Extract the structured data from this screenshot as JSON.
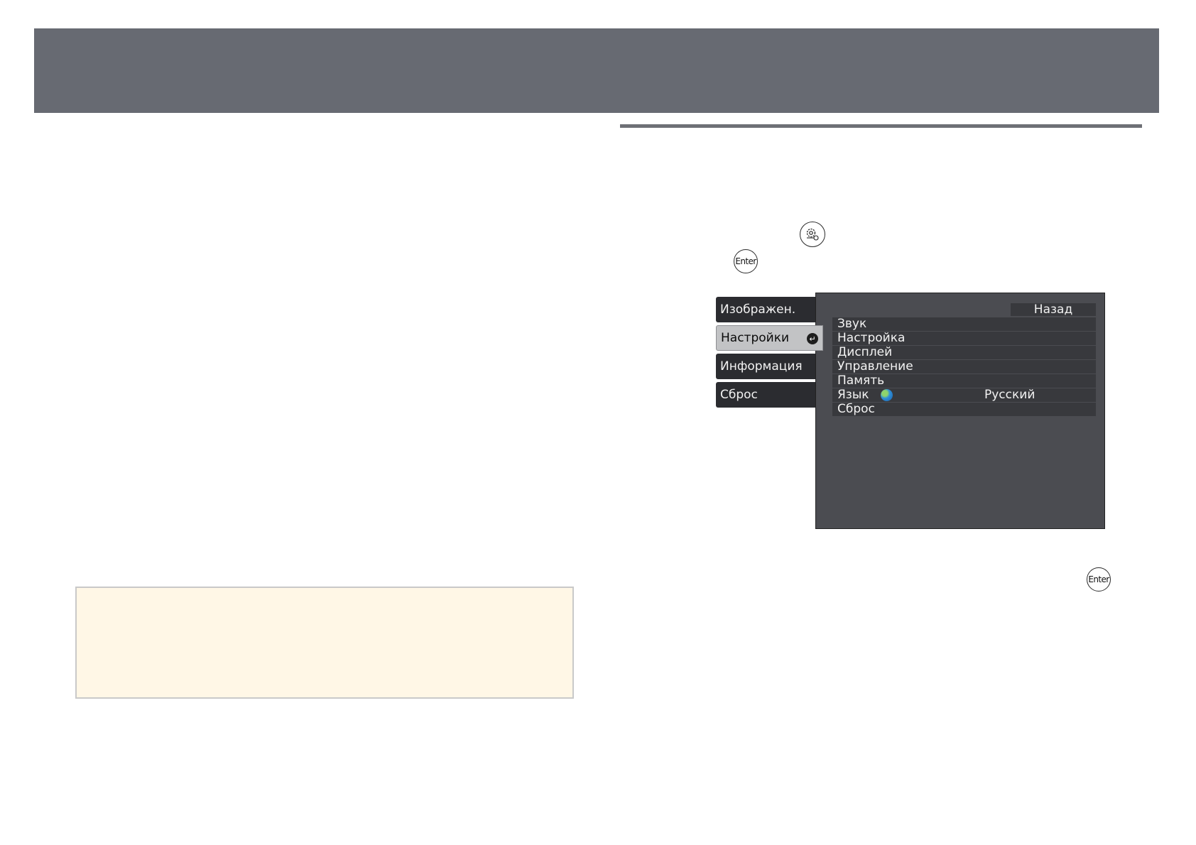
{
  "buttons": {
    "enter_label": "Enter"
  },
  "menu": {
    "tabs": [
      {
        "label": "Изображен."
      },
      {
        "label": "Настройки"
      },
      {
        "label": "Информация"
      },
      {
        "label": "Сброс"
      }
    ],
    "back_label": "Назад",
    "items": [
      {
        "label": "Звук"
      },
      {
        "label": "Настройка"
      },
      {
        "label": "Дисплей"
      },
      {
        "label": "Управление"
      },
      {
        "label": "Память"
      },
      {
        "label": "Язык",
        "value": "Русский"
      },
      {
        "label": "Сброс"
      }
    ]
  },
  "colors": {
    "header": "#676a72",
    "note_background": "#fff7e6",
    "menu_panel": "#4b4c51",
    "menu_tab": "#2b2c30",
    "menu_tab_active": "#c2c3c5"
  },
  "icons": {
    "settings": "settings-gear-icon",
    "enter": "enter-button-icon",
    "tab_selected": "enter-arrow-icon",
    "language": "globe-icon"
  }
}
